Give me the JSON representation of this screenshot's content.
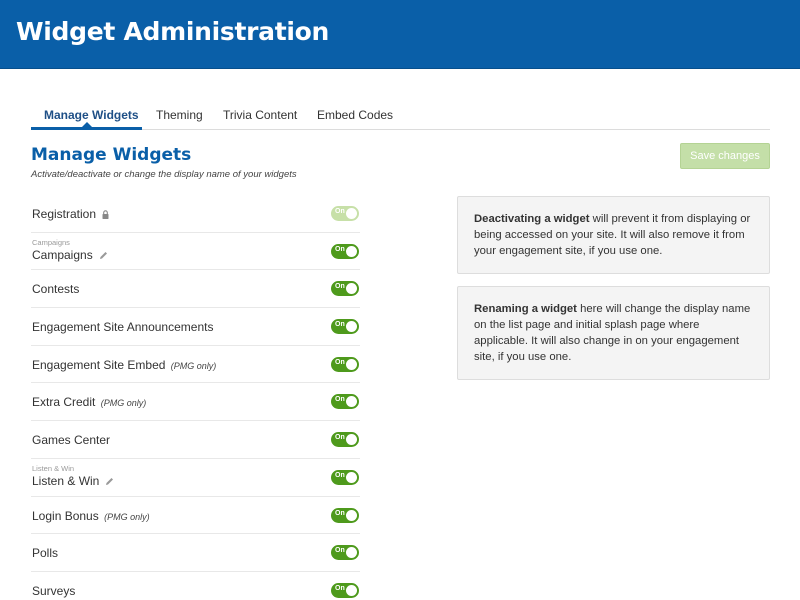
{
  "header": {
    "title": "Widget Administration"
  },
  "tabs": [
    {
      "label": "Manage Widgets",
      "active": true
    },
    {
      "label": "Theming",
      "active": false
    },
    {
      "label": "Trivia Content",
      "active": false
    },
    {
      "label": "Embed Codes",
      "active": false
    }
  ],
  "section": {
    "title": "Manage Widgets",
    "subtitle": "Activate/deactivate or change the display name of your widgets"
  },
  "save_button": {
    "label": "Save changes",
    "enabled": false
  },
  "widgets": [
    {
      "name": "Registration",
      "sublabel": "",
      "note": "",
      "icon": "lock-icon",
      "toggle": "On",
      "toggle_enabled": false
    },
    {
      "name": "Campaigns",
      "sublabel": "Campaigns",
      "note": "",
      "icon": "pencil-icon",
      "toggle": "On",
      "toggle_enabled": true
    },
    {
      "name": "Contests",
      "sublabel": "",
      "note": "",
      "icon": "",
      "toggle": "On",
      "toggle_enabled": true
    },
    {
      "name": "Engagement Site Announcements",
      "sublabel": "",
      "note": "",
      "icon": "",
      "toggle": "On",
      "toggle_enabled": true
    },
    {
      "name": "Engagement Site Embed",
      "sublabel": "",
      "note": "(PMG only)",
      "icon": "",
      "toggle": "On",
      "toggle_enabled": true
    },
    {
      "name": "Extra Credit",
      "sublabel": "",
      "note": "(PMG only)",
      "icon": "",
      "toggle": "On",
      "toggle_enabled": true
    },
    {
      "name": "Games Center",
      "sublabel": "",
      "note": "",
      "icon": "",
      "toggle": "On",
      "toggle_enabled": true
    },
    {
      "name": "Listen & Win",
      "sublabel": "Listen & Win",
      "note": "",
      "icon": "pencil-icon",
      "toggle": "On",
      "toggle_enabled": true
    },
    {
      "name": "Login Bonus",
      "sublabel": "",
      "note": "(PMG only)",
      "icon": "",
      "toggle": "On",
      "toggle_enabled": true
    },
    {
      "name": "Polls",
      "sublabel": "",
      "note": "",
      "icon": "",
      "toggle": "On",
      "toggle_enabled": true
    },
    {
      "name": "Surveys",
      "sublabel": "",
      "note": "",
      "icon": "",
      "toggle": "On",
      "toggle_enabled": true
    }
  ],
  "info_boxes": [
    {
      "bold": "Deactivating a widget",
      "text": " will prevent it from displaying or being accessed on your site. It will also remove it from your engagement site, if you use one."
    },
    {
      "bold": "Renaming a widget",
      "text": " here will change the display name on the list page and initial splash page where applicable. It will also change in on your engagement site, if you use one."
    }
  ],
  "colors": {
    "brand_blue": "#0a5fa8",
    "toggle_on": "#4e9a1c",
    "toggle_disabled": "#c7e0a8",
    "save_disabled": "#c4dfa8"
  }
}
